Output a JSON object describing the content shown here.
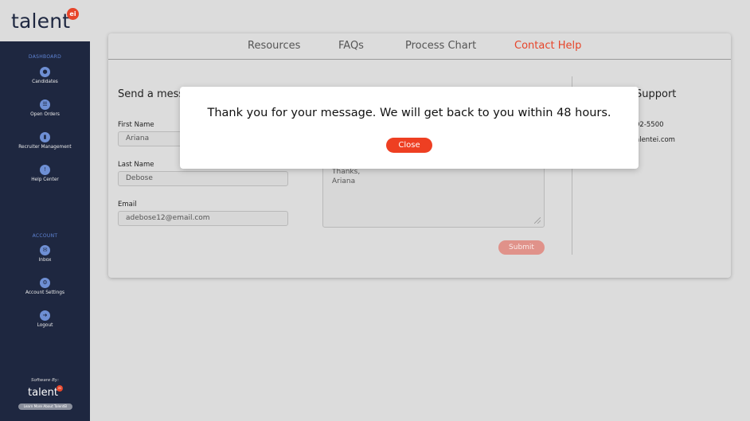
{
  "brand": {
    "logo_text": "talent",
    "logo_badge": "ei"
  },
  "sidebar": {
    "section_dashboard": "DASHBOARD",
    "section_account": "ACCOUNT",
    "items": [
      {
        "label": "Candidates",
        "icon": "candidates-icon"
      },
      {
        "label": "Open Orders",
        "icon": "orders-icon"
      },
      {
        "label": "Recruiter Management",
        "icon": "recruiter-icon"
      },
      {
        "label": "Help Center",
        "icon": "help-icon"
      },
      {
        "label": "Inbox",
        "icon": "inbox-icon"
      },
      {
        "label": "Account Settings",
        "icon": "settings-icon"
      },
      {
        "label": "Logout",
        "icon": "logout-icon"
      }
    ],
    "software_by": "Software By:",
    "footer_logo": "talent",
    "footer_badge": "ei",
    "learn_more": "Learn More About TalentEI"
  },
  "tabs": [
    {
      "label": "Resources",
      "active": false
    },
    {
      "label": "FAQs",
      "active": false
    },
    {
      "label": "Process Chart",
      "active": false
    },
    {
      "label": "Contact Help",
      "active": true
    }
  ],
  "form": {
    "title_visible": "Send a mess",
    "first_name_label": "First Name",
    "first_name_value": "Ariana",
    "last_name_label": "Last Name",
    "last_name_value": "Debose",
    "email_label": "Email",
    "email_value": "adebose12@email.com",
    "message_line1": "Thanks,",
    "message_line2": "Ariana",
    "submit_label": "Submit"
  },
  "support": {
    "title_visible": "Support",
    "phone_visible": "02-5500",
    "email_visible": "alentei.com"
  },
  "modal": {
    "message": "Thank you for your message. We will get back to you within 48 hours.",
    "close_label": "Close"
  },
  "colors": {
    "sidebar_bg": "#1e2740",
    "accent": "#e7452a",
    "page_bg": "#dcdcdc",
    "nav_section": "#5f84d4"
  }
}
